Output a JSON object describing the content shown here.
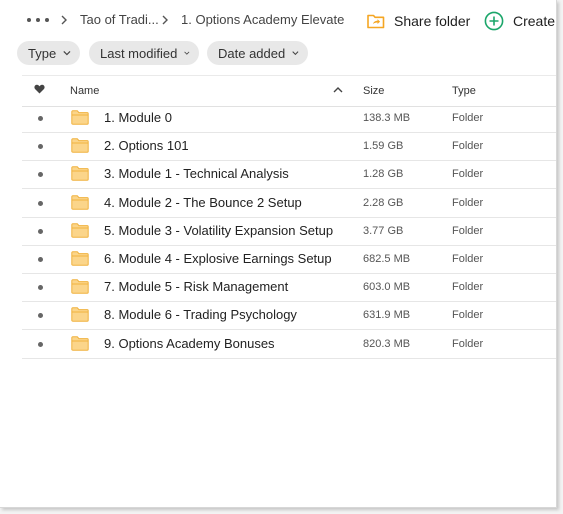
{
  "breadcrumb": {
    "more_icon": "ellipsis-icon",
    "items": [
      "Tao of Tradi...",
      "1. Options Academy Elevate"
    ]
  },
  "toolbar": {
    "share_label": "Share folder",
    "share_icon": "shared-folder-icon",
    "create_label": "Create fo",
    "create_icon": "plus-circle-icon",
    "accent_color": "#f5a623",
    "create_color": "#1ba66a"
  },
  "filters": [
    "Type",
    "Last modified",
    "Date added"
  ],
  "table": {
    "columns": {
      "favorite_icon": "heart-icon",
      "name": "Name",
      "size": "Size",
      "type": "Type"
    },
    "sort": "name-ascending",
    "rows": [
      {
        "name": "1. Module 0",
        "size": "138.3 MB",
        "type": "Folder"
      },
      {
        "name": "2. Options 101",
        "size": "1.59 GB",
        "type": "Folder"
      },
      {
        "name": "3. Module 1 - Technical Analysis",
        "size": "1.28 GB",
        "type": "Folder"
      },
      {
        "name": "4. Module 2 - The Bounce 2 Setup",
        "size": "2.28 GB",
        "type": "Folder"
      },
      {
        "name": "5. Module 3 - Volatility Expansion Setup",
        "size": "3.77 GB",
        "type": "Folder"
      },
      {
        "name": "6. Module 4 - Explosive Earnings Setup",
        "size": "682.5 MB",
        "type": "Folder"
      },
      {
        "name": "7. Module 5 - Risk Management",
        "size": "603.0 MB",
        "type": "Folder"
      },
      {
        "name": "8. Module 6 - Trading Psychology",
        "size": "631.9 MB",
        "type": "Folder"
      },
      {
        "name": "9. Options Academy Bonuses",
        "size": "820.3 MB",
        "type": "Folder"
      }
    ]
  }
}
